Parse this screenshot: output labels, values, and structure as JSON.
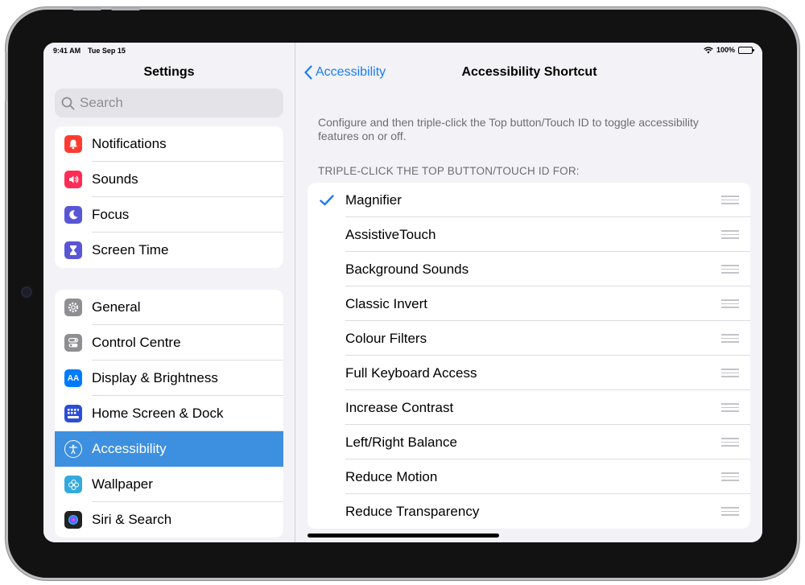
{
  "status_bar": {
    "time": "9:41 AM",
    "date": "Tue Sep 15",
    "battery": "100%"
  },
  "sidebar": {
    "title": "Settings",
    "search_placeholder": "Search",
    "group1": [
      {
        "label": "Notifications",
        "icon": "bell-icon",
        "color": "#ff3b30"
      },
      {
        "label": "Sounds",
        "icon": "speaker-icon",
        "color": "#ff2d55"
      },
      {
        "label": "Focus",
        "icon": "moon-icon",
        "color": "#5856d6"
      },
      {
        "label": "Screen Time",
        "icon": "hourglass-icon",
        "color": "#5856d6"
      }
    ],
    "group2": [
      {
        "label": "General",
        "icon": "gear-icon",
        "color": "#8e8e93"
      },
      {
        "label": "Control Centre",
        "icon": "toggles-icon",
        "color": "#8e8e93"
      },
      {
        "label": "Display & Brightness",
        "icon": "text-size-icon",
        "color": "#007aff"
      },
      {
        "label": "Home Screen & Dock",
        "icon": "grid-icon",
        "color": "#2c4ed6"
      },
      {
        "label": "Accessibility",
        "icon": "accessibility-icon",
        "color": "#007aff",
        "selected": true
      },
      {
        "label": "Wallpaper",
        "icon": "flower-icon",
        "color": "#34aadc"
      },
      {
        "label": "Siri & Search",
        "icon": "siri-icon",
        "color": "#222222"
      }
    ]
  },
  "detail": {
    "back_label": "Accessibility",
    "title": "Accessibility Shortcut",
    "description": "Configure and then triple-click the Top button/Touch ID to toggle accessibility features on or off.",
    "section_header": "TRIPLE-CLICK THE TOP BUTTON/TOUCH ID FOR:",
    "items": [
      {
        "label": "Magnifier",
        "checked": true
      },
      {
        "label": "AssistiveTouch",
        "checked": false
      },
      {
        "label": "Background Sounds",
        "checked": false
      },
      {
        "label": "Classic Invert",
        "checked": false
      },
      {
        "label": "Colour Filters",
        "checked": false
      },
      {
        "label": "Full Keyboard Access",
        "checked": false
      },
      {
        "label": "Increase Contrast",
        "checked": false
      },
      {
        "label": "Left/Right Balance",
        "checked": false
      },
      {
        "label": "Reduce Motion",
        "checked": false
      },
      {
        "label": "Reduce Transparency",
        "checked": false
      }
    ]
  },
  "colors": {
    "accent": "#1a7cf5",
    "selected_row": "#3d8fe0"
  }
}
